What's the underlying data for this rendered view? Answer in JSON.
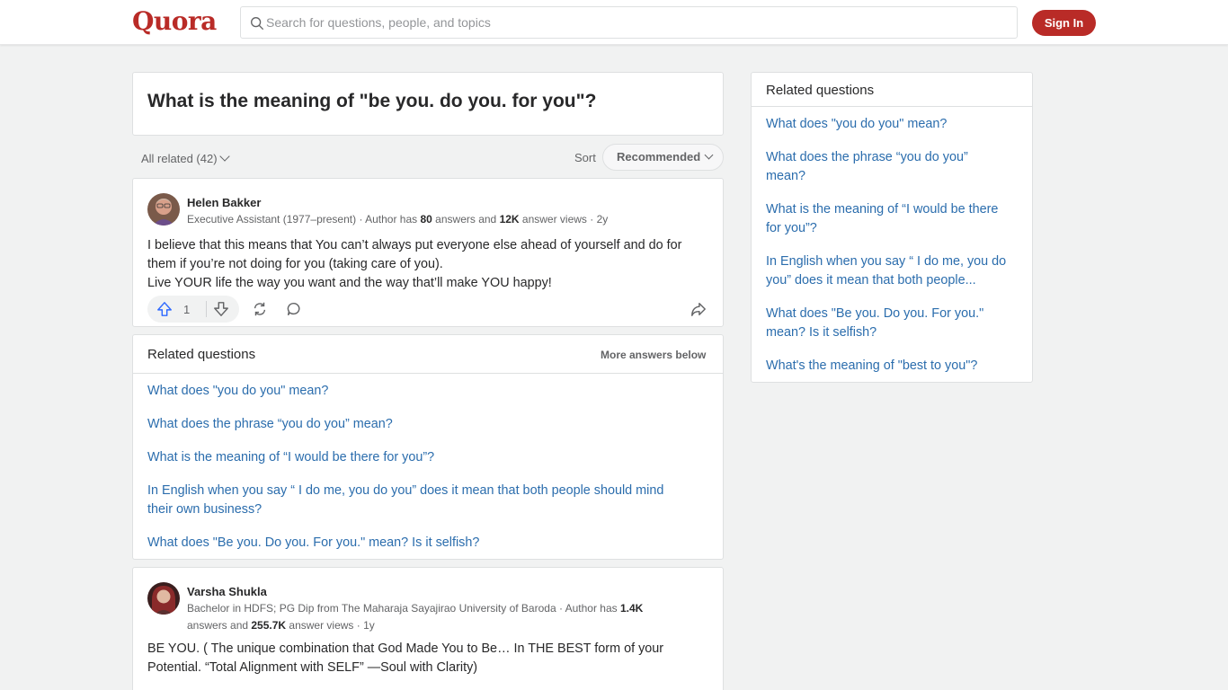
{
  "header": {
    "logo": "Quora",
    "search_placeholder": "Search for questions, people, and topics",
    "signin_label": "Sign In"
  },
  "question": {
    "title": "What is the meaning of \"be you. do you. for you\"?"
  },
  "filters": {
    "all_related": "All related (42)",
    "sort_label": "Sort",
    "sort_value": "Recommended"
  },
  "answers": [
    {
      "author": "Helen Bakker",
      "meta_prefix": "Executive Assistant (1977–present) · Author has ",
      "answers_count": "80",
      "meta_mid": " answers and ",
      "views_count": "12K",
      "meta_suffix": " answer views · 2y",
      "text_lines": [
        "I believe that this means that You can’t always put everyone else ahead of yourself and do for",
        "them if you’re not doing for you (taking care of you).",
        "Live YOUR life the way you want and the way that’ll make YOU happy!"
      ],
      "upvotes": "1"
    },
    {
      "author": "Varsha Shukla",
      "meta_line1_prefix": "Bachelor in HDFS; PG Dip from The Maharaja Sayajirao University of Baroda · Author has ",
      "answers_count": "1.4K",
      "meta_line2_prefix": "answers and ",
      "views_count": "255.7K",
      "meta_line2_suffix": " answer views · 1y",
      "text_lines": [
        "BE YOU. ( The unique combination that God Made You to Be… In THE BEST form of your",
        "Potential. “Total Alignment with SELF” —Soul with Clarity)"
      ]
    }
  ],
  "related_inline": {
    "title": "Related questions",
    "more": "More answers below",
    "items": [
      "What does \"you do you\" mean?",
      "What does the phrase “you do you” mean?",
      "What is the meaning of “I would be there for you”?",
      "In English when you say “ I do me, you do you” does it mean that both people should mind",
      "their own business?",
      "What does \"Be you. Do you. For you.\" mean? Is it selfish?"
    ]
  },
  "related_side": {
    "title": "Related questions",
    "items": [
      [
        "What does \"you do you\" mean?"
      ],
      [
        "What does the phrase “you do you”",
        "mean?"
      ],
      [
        "What is the meaning of “I would be there",
        "for you”?"
      ],
      [
        "In English when you say “ I do me, you do",
        "you” does it mean that both people..."
      ],
      [
        "What does \"Be you. Do you. For you.\"",
        "mean? Is it selfish?"
      ],
      [
        "What's the meaning of \"best to you\"?"
      ]
    ]
  },
  "colors": {
    "brand": "#b92b27",
    "link": "#2b6dad",
    "background": "#f1f2f2"
  }
}
